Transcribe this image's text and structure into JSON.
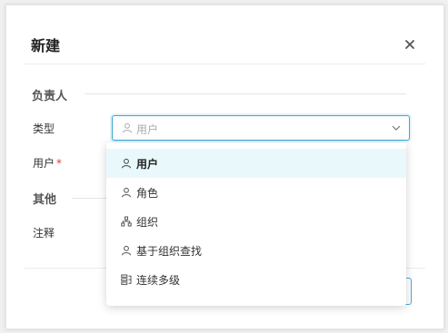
{
  "dialog": {
    "title": "新建",
    "close_icon": "close-icon"
  },
  "form": {
    "section_owner": "负责人",
    "type_label": "类型",
    "type_select": {
      "placeholder": "用户",
      "placeholder_icon": "user-icon",
      "chevron_icon": "chevron-down-icon"
    },
    "user_label": "用户",
    "required_mark": "*",
    "section_other": "其他",
    "notes_label": "注释"
  },
  "dropdown": {
    "options": [
      {
        "label": "用户",
        "icon": "user-icon",
        "active": true
      },
      {
        "label": "角色",
        "icon": "user-icon",
        "active": false
      },
      {
        "label": "组织",
        "icon": "org-chart-icon",
        "active": false
      },
      {
        "label": "基于组织查找",
        "icon": "user-icon",
        "active": false
      },
      {
        "label": "连续多级",
        "icon": "multilevel-icon",
        "active": false
      }
    ]
  },
  "colors": {
    "accent": "#1e9fd8",
    "active_option_bg": "#e9f9fb",
    "required": "#e03a3a"
  }
}
